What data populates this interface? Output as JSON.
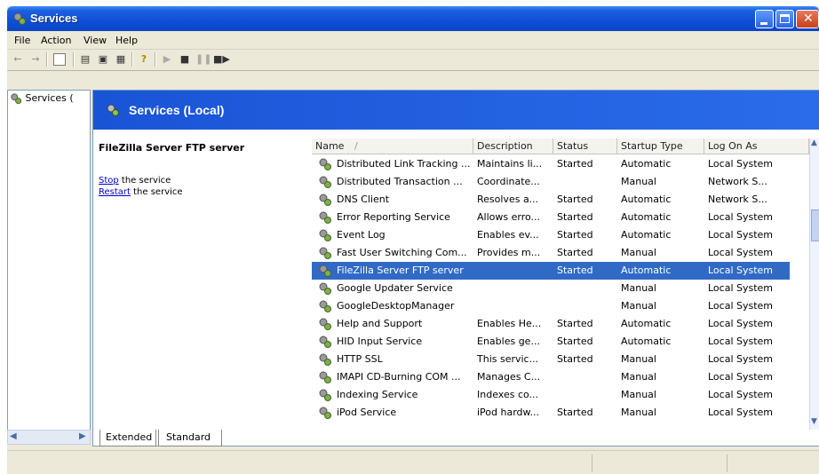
{
  "window": {
    "title": "Services"
  },
  "menu": [
    "File",
    "Action",
    "View",
    "Help"
  ],
  "tree": {
    "item_label": "Services ("
  },
  "header": {
    "title": "Services (Local)"
  },
  "description": {
    "service_name": "FileZilla Server FTP server",
    "stop_link": "Stop",
    "stop_rest": " the service",
    "restart_link": "Restart",
    "restart_rest": " the service"
  },
  "columns": [
    "Name",
    "Description",
    "Status",
    "Startup Type",
    "Log On As"
  ],
  "rows": [
    {
      "name": "Distributed Link Tracking ...",
      "description": "Maintains li...",
      "status": "Started",
      "startup": "Automatic",
      "logon": "Local System"
    },
    {
      "name": "Distributed Transaction ...",
      "description": "Coordinate...",
      "status": "",
      "startup": "Manual",
      "logon": "Network S..."
    },
    {
      "name": "DNS Client",
      "description": "Resolves a...",
      "status": "Started",
      "startup": "Automatic",
      "logon": "Network S..."
    },
    {
      "name": "Error Reporting Service",
      "description": "Allows erro...",
      "status": "Started",
      "startup": "Automatic",
      "logon": "Local System"
    },
    {
      "name": "Event Log",
      "description": "Enables ev...",
      "status": "Started",
      "startup": "Automatic",
      "logon": "Local System"
    },
    {
      "name": "Fast User Switching Com...",
      "description": "Provides m...",
      "status": "Started",
      "startup": "Manual",
      "logon": "Local System"
    },
    {
      "name": "FileZilla Server FTP server",
      "description": "",
      "status": "Started",
      "startup": "Automatic",
      "logon": "Local System",
      "selected": true
    },
    {
      "name": "Google Updater Service",
      "description": "",
      "status": "",
      "startup": "Manual",
      "logon": "Local System"
    },
    {
      "name": "GoogleDesktopManager",
      "description": "",
      "status": "",
      "startup": "Manual",
      "logon": "Local System"
    },
    {
      "name": "Help and Support",
      "description": "Enables He...",
      "status": "Started",
      "startup": "Automatic",
      "logon": "Local System"
    },
    {
      "name": "HID Input Service",
      "description": "Enables ge...",
      "status": "Started",
      "startup": "Automatic",
      "logon": "Local System"
    },
    {
      "name": "HTTP SSL",
      "description": "This servic...",
      "status": "Started",
      "startup": "Manual",
      "logon": "Local System"
    },
    {
      "name": "IMAPI CD-Burning COM ...",
      "description": "Manages C...",
      "status": "",
      "startup": "Manual",
      "logon": "Local System"
    },
    {
      "name": "Indexing Service",
      "description": "Indexes co...",
      "status": "",
      "startup": "Manual",
      "logon": "Local System"
    },
    {
      "name": "iPod Service",
      "description": "iPod hardw...",
      "status": "Started",
      "startup": "Manual",
      "logon": "Local System"
    }
  ],
  "tabs": [
    "Extended",
    "Standard"
  ],
  "colors": {
    "titlebar": "#0f4fd6",
    "selection": "#316ac5",
    "link": "#0000cc"
  },
  "icons": [
    "services-gear-icon",
    "back-arrow-icon",
    "forward-arrow-icon",
    "play-icon",
    "stop-icon",
    "pause-icon",
    "restart-icon"
  ]
}
